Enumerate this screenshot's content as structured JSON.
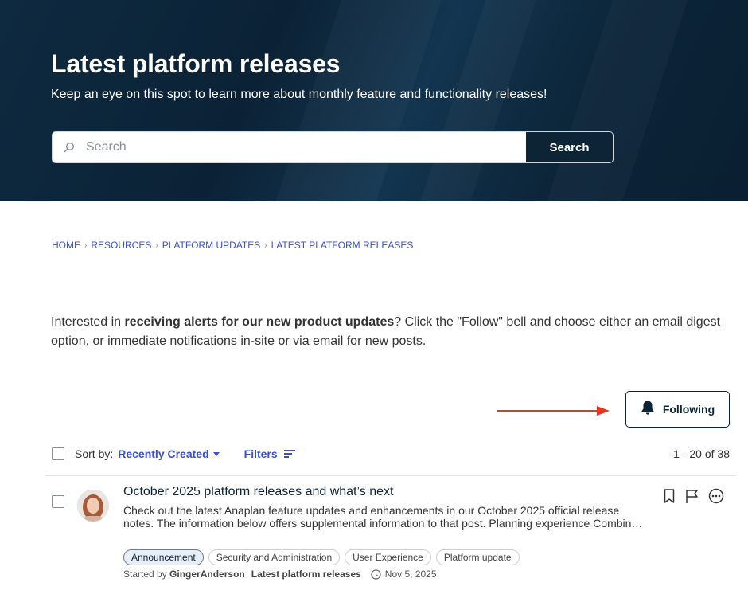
{
  "hero": {
    "title": "Latest platform releases",
    "subtitle": "Keep an eye on this spot to learn more about monthly feature and functionality releases!",
    "search_placeholder": "Search",
    "search_button": "Search"
  },
  "breadcrumb": [
    {
      "label": "HOME"
    },
    {
      "label": "RESOURCES"
    },
    {
      "label": "PLATFORM UPDATES"
    },
    {
      "label": "LATEST PLATFORM RELEASES"
    }
  ],
  "intro": {
    "before": "Interested in ",
    "bold": "receiving alerts for our new product updates",
    "after": "? Click the \"Follow\" bell and choose either an email digest option, or immediate notifications in-site or via email for new posts."
  },
  "follow_button": {
    "label": "Following"
  },
  "toolbar": {
    "sort_by_label": "Sort by:",
    "sort_value": "Recently Created",
    "filters_label": "Filters",
    "count": "1 - 20 of 38"
  },
  "posts": [
    {
      "title": "October 2025 platform releases and what’s next",
      "excerpt": "Check out the latest Anaplan feature updates and enhancements in our October 2025 official release notes. The information below offers supplemental information to that post. Planning experience Combin…",
      "tags": [
        "Announcement",
        "Security and Administration",
        "User Experience",
        "Platform update"
      ],
      "started_by_label": "Started by",
      "author": "GingerAnderson",
      "board": "Latest platform releases",
      "date": "Nov 5, 2025"
    }
  ],
  "colors": {
    "hero_bg": "#0b2236",
    "link": "#3c50c8",
    "arrow": "#e8361e",
    "button_dark": "#0d2336"
  }
}
